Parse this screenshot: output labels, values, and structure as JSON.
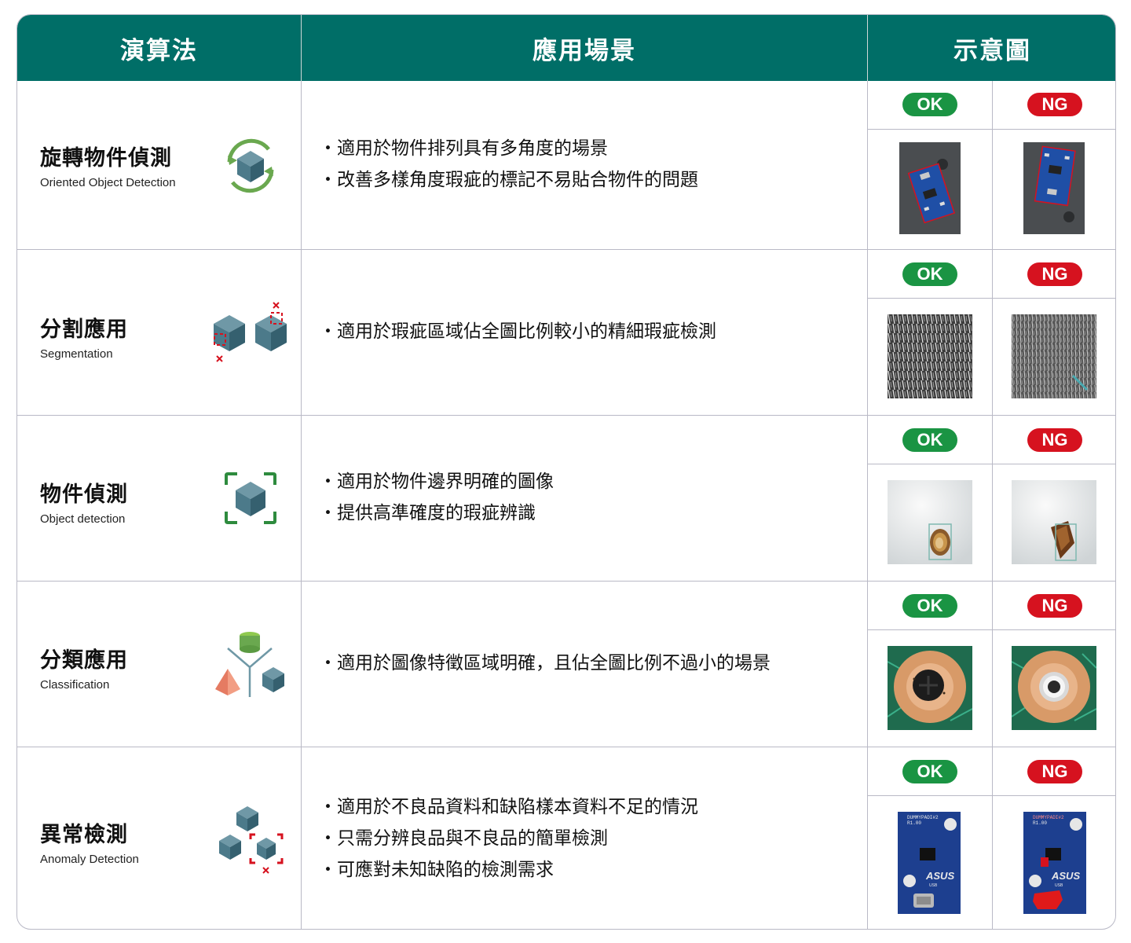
{
  "header": {
    "algorithm": "演算法",
    "scenario": "應用場景",
    "illustration": "示意圖"
  },
  "badges": {
    "ok": "OK",
    "ng": "NG"
  },
  "colors": {
    "header_bg": "#006e67",
    "ok": "#1a9443",
    "ng": "#d6121f",
    "icon_green": "#6aa84f",
    "icon_teal": "#3d6b7a",
    "icon_red": "#d6121f"
  },
  "rows": [
    {
      "name_zh": "旋轉物件偵測",
      "name_en": "Oriented Object Detection",
      "icon": "rotate-cube-icon",
      "scenes": [
        "・適用於物件排列具有多角度的場景",
        "・改善多樣角度瑕疵的標記不易貼合物件的問題"
      ]
    },
    {
      "name_zh": "分割應用",
      "name_en": "Segmentation",
      "icon": "segment-cubes-icon",
      "scenes": [
        "・適用於瑕疵區域佔全圖比例較小的精細瑕疵檢測"
      ]
    },
    {
      "name_zh": "物件偵測",
      "name_en": "Object detection",
      "icon": "focus-cube-icon",
      "scenes": [
        "・適用於物件邊界明確的圖像",
        "・提供高準確度的瑕疵辨識"
      ]
    },
    {
      "name_zh": "分類應用",
      "name_en": "Classification",
      "icon": "classify-shapes-icon",
      "scenes": [
        "・適用於圖像特徵區域明確，且佔全圖比例不過小的場景"
      ]
    },
    {
      "name_zh": "異常檢測",
      "name_en": "Anomaly Detection",
      "icon": "anomaly-cubes-icon",
      "scenes": [
        "・適用於不良品資料和缺陷樣本資料不足的情況",
        "・只需分辨良品與不良品的簡單檢測",
        "・可應對未知缺陷的檢測需求"
      ]
    }
  ],
  "board_text": {
    "brand": "ASUS",
    "model": "DUMMYPADI#2",
    "ver": "R1.00",
    "usb": "USB"
  }
}
